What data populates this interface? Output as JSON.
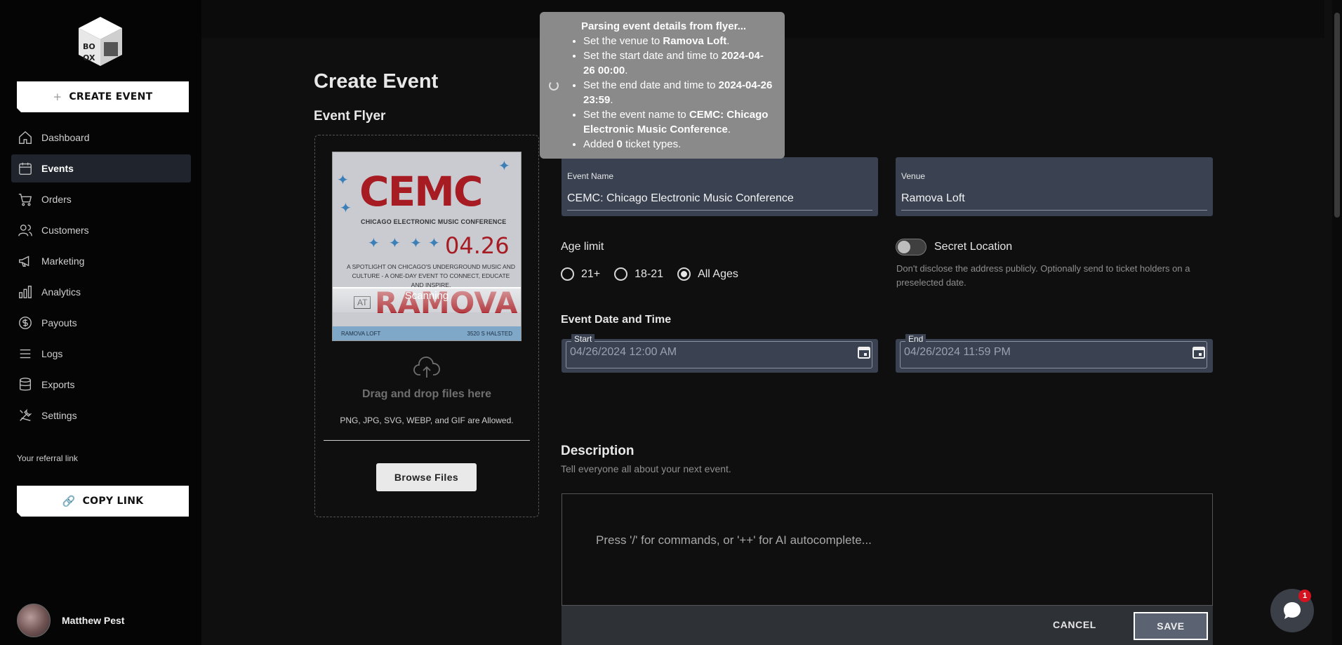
{
  "sidebar": {
    "create_event_label": "CREATE EVENT",
    "nav": [
      {
        "label": "Dashboard",
        "icon": "home-icon",
        "active": false
      },
      {
        "label": "Events",
        "icon": "calendar-icon",
        "active": true
      },
      {
        "label": "Orders",
        "icon": "cart-icon",
        "active": false
      },
      {
        "label": "Customers",
        "icon": "users-icon",
        "active": false
      },
      {
        "label": "Marketing",
        "icon": "megaphone-icon",
        "active": false
      },
      {
        "label": "Analytics",
        "icon": "bar-chart-icon",
        "active": false
      },
      {
        "label": "Payouts",
        "icon": "dollar-icon",
        "active": false
      },
      {
        "label": "Logs",
        "icon": "list-icon",
        "active": false
      },
      {
        "label": "Exports",
        "icon": "database-icon",
        "active": false
      },
      {
        "label": "Settings",
        "icon": "tools-icon",
        "active": false
      }
    ],
    "referral_label": "Your referral link",
    "copy_link_label": "COPY LINK",
    "user_name": "Matthew Pest"
  },
  "main": {
    "title": "Create Event",
    "flyer_title": "Event Flyer",
    "flyer": {
      "brand": "CEMC",
      "subtitle": "CHICAGO ELECTRONIC MUSIC CONFERENCE",
      "date": "04.26",
      "blurb": "A SPOTLIGHT ON CHICAGO'S UNDERGROUND MUSIC AND CULTURE - A ONE-DAY EVENT TO CONNECT, EDUCATE AND INSPIRE.",
      "at": "AT",
      "venue_art": "RAMOVA",
      "footer_left": "RAMOVA LOFT",
      "footer_right": "3520 S HALSTED",
      "scanning": "Scanning"
    },
    "dropzone": {
      "drag_text": "Drag and drop files here",
      "allowed": "PNG, JPG, SVG, WEBP, and GIF are Allowed.",
      "browse": "Browse Files"
    },
    "event_name": {
      "label": "Event Name",
      "value": "CEMC: Chicago Electronic Music Conference"
    },
    "venue": {
      "label": "Venue",
      "value": "Ramova Loft"
    },
    "age_limit": {
      "label": "Age limit",
      "options": [
        "21+",
        "18-21",
        "All Ages"
      ],
      "selected": "All Ages"
    },
    "secret_location": {
      "label": "Secret Location",
      "enabled": false,
      "help": "Don't disclose the address publicly. Optionally send to ticket holders on a preselected date."
    },
    "date_time": {
      "label": "Event Date and Time",
      "start_label": "Start",
      "start_value": "04/26/2024 12:00 AM",
      "end_label": "End",
      "end_value": "04/26/2024 11:59 PM"
    },
    "description": {
      "title": "Description",
      "help": "Tell everyone all about your next event.",
      "placeholder": "Press '/' for commands, or '++' for AI autocomplete..."
    },
    "actions": {
      "cancel": "CANCEL",
      "save": "SAVE"
    }
  },
  "popup": {
    "title": "Parsing event details from flyer...",
    "items": {
      "venue_prefix": "Set the venue to ",
      "venue": "Ramova Loft",
      "start_prefix": "Set the start date and time to ",
      "start": "2024-04-26 00:00",
      "end_prefix": "Set the end date and time to ",
      "end": "2024-04-26 23:59",
      "name_prefix": "Set the event name to ",
      "name": "CEMC: Chicago Electronic Music Conference",
      "tickets_prefix": "Added ",
      "tickets": "0",
      "tickets_suffix": " ticket types."
    }
  },
  "chat": {
    "badge": "1"
  }
}
